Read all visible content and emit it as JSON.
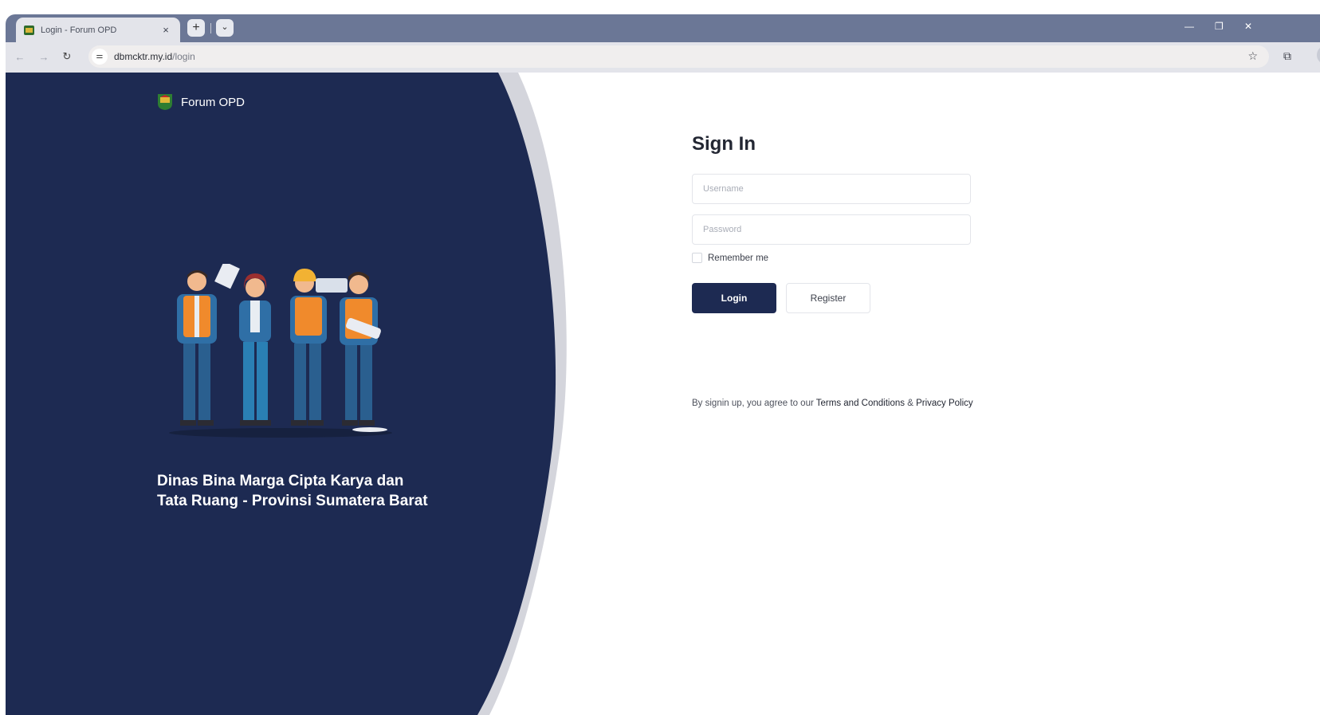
{
  "browser": {
    "tab_title": "Login - Forum OPD",
    "tab_close": "×",
    "new_tab": "+",
    "url_host": "dbmcktr.my.id",
    "url_path": "/login"
  },
  "brand": {
    "name": "Forum OPD"
  },
  "hero": {
    "line1": "Dinas Bina Marga Cipta Karya dan",
    "line2": "Tata Ruang - Provinsi Sumatera Barat"
  },
  "signin": {
    "title": "Sign In",
    "username_placeholder": "Username",
    "password_placeholder": "Password",
    "remember_label": "Remember me",
    "login_label": "Login",
    "register_label": "Register"
  },
  "terms": {
    "prefix": "By signin up, you agree to our ",
    "terms_link": "Terms and Conditions",
    "amp": " & ",
    "privacy_link": "Privacy Policy"
  },
  "colors": {
    "panel": "#1d2a52",
    "primary_button": "#1d2a52",
    "tab_strip": "#6b7796"
  },
  "icons": [
    "back-icon",
    "forward-icon",
    "reload-icon",
    "site-info-icon",
    "star-icon",
    "extensions-icon",
    "profile-icon",
    "minimize-icon",
    "maximize-icon",
    "close-icon"
  ]
}
